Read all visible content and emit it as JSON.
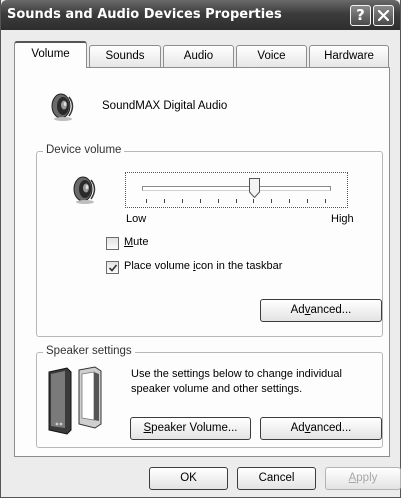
{
  "window": {
    "title": "Sounds and Audio Devices Properties",
    "help_label": "?"
  },
  "tabs": [
    {
      "label": "Volume",
      "active": true
    },
    {
      "label": "Sounds",
      "active": false
    },
    {
      "label": "Audio",
      "active": false
    },
    {
      "label": "Voice",
      "active": false
    },
    {
      "label": "Hardware",
      "active": false
    }
  ],
  "device": {
    "name": "SoundMAX Digital Audio"
  },
  "device_volume": {
    "group_label": "Device volume",
    "slider_low_label": "Low",
    "slider_high_label": "High",
    "slider_level": 0.6,
    "mute": {
      "pre": "",
      "accel": "M",
      "post": "ute",
      "checked": false
    },
    "place_icon": {
      "pre": "Place volume ",
      "accel": "i",
      "post": "con in the taskbar",
      "checked": true
    },
    "advanced_button": {
      "pre": "Ad",
      "accel": "v",
      "post": "anced..."
    }
  },
  "speaker_settings": {
    "group_label": "Speaker settings",
    "description_line1": "Use the settings below to change individual",
    "description_line2": "speaker volume and other settings.",
    "speaker_volume_button": {
      "pre": "",
      "accel": "S",
      "post": "peaker Volume..."
    },
    "advanced_button": {
      "pre": "Ad",
      "accel": "v",
      "post": "anced..."
    }
  },
  "footer": {
    "ok_label": "OK",
    "cancel_label": "Cancel",
    "apply": {
      "pre": "",
      "accel": "A",
      "post": "pply"
    }
  },
  "icons": {
    "device": "speaker-icon",
    "volume": "speaker-icon",
    "speakers": "desktop-speakers-icon",
    "close": "close-icon"
  },
  "colors": {
    "titlebar": "#3c3c3c",
    "dialog_bg": "#ececec",
    "panel_bg": "#fdfdfd",
    "disabled_text": "#a8a8a8"
  }
}
